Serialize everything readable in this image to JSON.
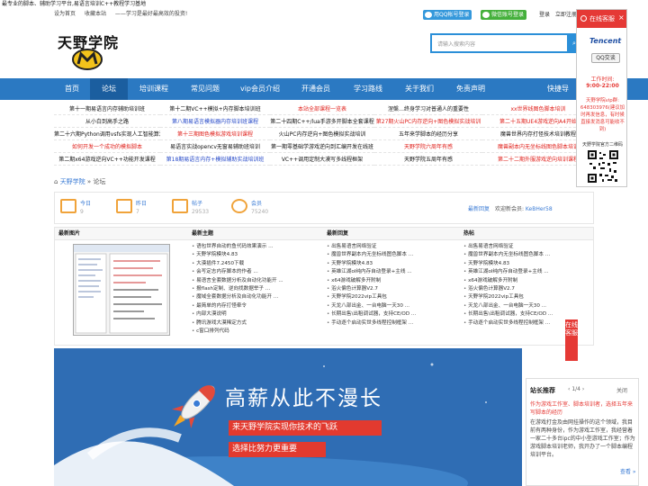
{
  "top": {
    "strip": "最专业的脚本、辅助学习平台,易语言培训C++教程学习基地",
    "home": "设为首页",
    "fav": "收藏本站",
    "slogan": "——学习是最好最高效的投资!",
    "qq_login": "用QQ帐号登录",
    "wx_login": "微信账号登录",
    "login": "登录",
    "register": "立即注册"
  },
  "logo": {
    "text": "天野学院"
  },
  "search": {
    "placeholder": "请输入搜索内容",
    "button": "搜"
  },
  "nav": [
    "首页",
    "论坛",
    "培训课程",
    "常见问题",
    "vip会员介绍",
    "开通会员",
    "学习路线",
    "关于我们",
    "免责声明",
    "快捷导"
  ],
  "links": [
    [
      {
        "t": "第十一期易语言内存辅助培训班",
        "c": "#111"
      },
      {
        "t": "第十二期VC++模拟+内存脚本培训班",
        "c": "#111"
      },
      {
        "t": "本站全部课程一览表",
        "c": "#e0201b"
      },
      {
        "t": "涅槃…终身学习对普通人的重要性",
        "c": "#111"
      },
      {
        "t": "xx世界线图色脚本培训",
        "c": "#e0201b"
      }
    ],
    [
      {
        "t": "从小白到高手之路",
        "c": "#111"
      },
      {
        "t": "第八期易语言模拟器内存培训班课程",
        "c": "#2649c8"
      },
      {
        "t": "第二十四期C++/lua手游多开脚本全套课程",
        "c": "#111"
      },
      {
        "t": "第27期火山PC内存逆向+图色模拟实战培训",
        "c": "#e0201b"
      },
      {
        "t": "第二十五期UE4游戏逆向A4开始",
        "c": "#e0201b"
      }
    ],
    [
      {
        "t": "第二十六期Python调用vsfs实现人工智能算法",
        "c": "#111"
      },
      {
        "t": "第十三期图色模拟游戏培训课程",
        "c": "#e0201b"
      },
      {
        "t": "火山PC内存逆向+图色模拟实战培训",
        "c": "#111"
      },
      {
        "t": "五年来学脚本的经历分享",
        "c": "#111"
      },
      {
        "t": "魔兽世界内存打怪技术培训教程",
        "c": "#111"
      }
    ],
    [
      {
        "t": "如何开发一个成功的模拟脚本",
        "c": "#e0201b"
      },
      {
        "t": "易语言实战opencv无窗易辅助班培训",
        "c": "#111"
      },
      {
        "t": "第一期零基础学游戏逆向到汇编开发在线班",
        "c": "#111"
      },
      {
        "t": "天野学院六周年有感",
        "c": "#e0201b"
      },
      {
        "t": "魔兽副本内无坐标线图色脚本培训",
        "c": "#e0201b"
      }
    ],
    [
      {
        "t": "第二期x64游戏逆向VC++功能开发课程",
        "c": "#111"
      },
      {
        "t": "第18期易语言内存+模拟辅助实战培训班",
        "c": "#2649c8"
      },
      {
        "t": "VC++调用定制大漠写多线程框架",
        "c": "#111"
      },
      {
        "t": "天野学院五周年有感",
        "c": "#111"
      },
      {
        "t": "第二十二期外服游戏逆向培训课程",
        "c": "#e0201b"
      }
    ]
  ],
  "crumb": {
    "home": "天野学院",
    "sep": "»",
    "page": "论坛"
  },
  "stats": [
    {
      "label": "今日",
      "num": "9"
    },
    {
      "label": "昨日",
      "num": "7"
    },
    {
      "label": "帖子",
      "num": "29533"
    },
    {
      "label": "会员",
      "num": "75240"
    }
  ],
  "newmem": {
    "latest": "最新回复",
    "welcome": "欢迎新会员:",
    "name": "KeBHer58"
  },
  "panels": {
    "h1": "最新图片",
    "h2": "最新主题",
    "h3": "最新回复",
    "h4": "热帖",
    "topics": [
      "语包世界自动的鱼代码效果演示 ...",
      "天野学院模块4.83",
      "大漠插件7.2450下载",
      "会写定志内存脚本的作者 ...",
      "易语言全套数据分析及自动化功能开 ...",
      "报flash定制、逆向找数据举子 ...",
      "魔域全套数据分析及自动化功能开 ...",
      "最简单的内存打怪牵令",
      "内部大漠说明",
      "腾讯游戏大漠稀定方式",
      "c窗口排列代码"
    ],
    "replies": [
      "出售易语言网络验证",
      "魔兽世界副本内无坐标线图色脚本 ...",
      "天野学院模块4.83",
      "英雄江湖ol纯内存自动登录+主线 ...",
      "x64游戏破解多开附制",
      "浴火偏色计算器V2.7",
      "天野学院2022vip工具包",
      "天龙八部出金、一台电脑一天30 ...",
      "长期出售\\出租调试器，支持CE/OD ...",
      "手动逐个启动实世多线程控制框架 ..."
    ],
    "hot": [
      "出售易语言网络验证",
      "魔兽世界副本内无坐标线图色脚本 ...",
      "天野学院模块4.83",
      "英雄江湖ol纯内存自动登录+主线 ...",
      "x64游戏破解多开附制",
      "浴火偏色计算器V2.7",
      "天野学院2022vip工具包",
      "天龙八部出金、一台电脑一天30 ...",
      "长期出售\\出租调试器，支持CE/OD ...",
      "手动逐个启动实世多线程控制框架 ..."
    ]
  },
  "banner": {
    "big": "高薪从此不漫长",
    "line1": "来天野学院实现你技术的飞跃",
    "line2": "选择比努力更重要"
  },
  "side": {
    "title": "站长推荐",
    "page": "1/4",
    "close": "关闭",
    "link": "作为游戏工作室、脚本培训者，选择五年来写脚本的经历",
    "text": "在游戏打金及由网挂操作的这个领域，我目前有两种身份，作为游戏工作室，我经营着一家二十多台ipc的中小型游戏工作室；作为游戏脚本培训老师，我开办了一个脚本编程培训平台。",
    "more": "查看 »"
  },
  "float": {
    "title": "在线客服",
    "logo": "Tencent",
    "qq": "QQ交谈",
    "hours_label": "工作时间:",
    "hours": "9:00-22:00",
    "note": "天野学院vip群: 648303976(建议加时再发信息，有时候直接发消息可能收不到)",
    "qr_caption": "天野学院官方二维码"
  },
  "tab": "在线客服"
}
